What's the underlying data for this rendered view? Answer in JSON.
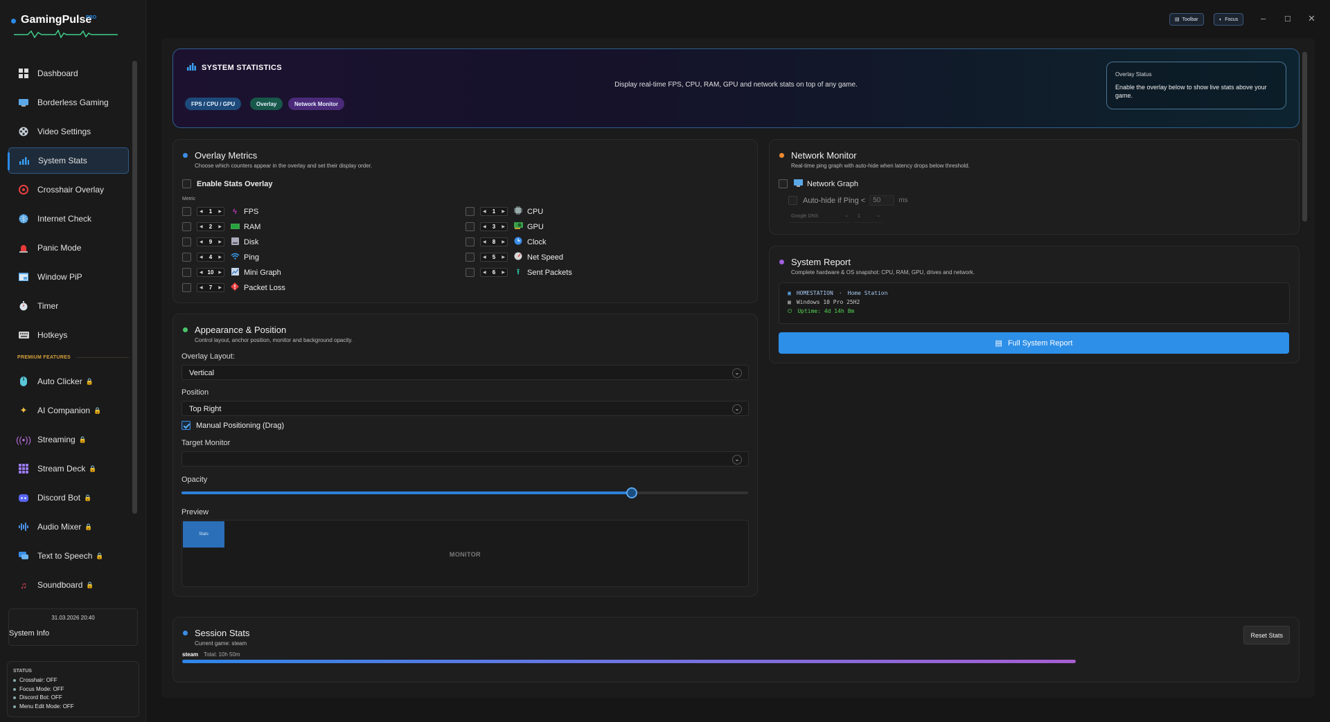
{
  "app": {
    "name": "GamingPulse",
    "badge": "PRO"
  },
  "window": {
    "toolbar_btn": "Toolbar",
    "focus_btn": "Focus"
  },
  "sidebar": {
    "items": [
      {
        "label": "Dashboard",
        "icon": "dashboard-icon"
      },
      {
        "label": "Borderless Gaming",
        "icon": "monitor-icon"
      },
      {
        "label": "Video Settings",
        "icon": "film-reel-icon"
      },
      {
        "label": "System Stats",
        "icon": "bar-chart-icon",
        "active": true
      },
      {
        "label": "Crosshair Overlay",
        "icon": "crosshair-icon"
      },
      {
        "label": "Internet Check",
        "icon": "globe-icon"
      },
      {
        "label": "Panic Mode",
        "icon": "siren-icon"
      },
      {
        "label": "Window PiP",
        "icon": "pip-window-icon"
      },
      {
        "label": "Timer",
        "icon": "stopwatch-icon"
      },
      {
        "label": "Hotkeys",
        "icon": "keyboard-icon"
      }
    ],
    "premium_label": "PREMIUM FEATURES",
    "premium_items": [
      {
        "label": "Auto Clicker",
        "icon": "mouse-icon"
      },
      {
        "label": "AI Companion",
        "icon": "sparkles-icon"
      },
      {
        "label": "Streaming",
        "icon": "broadcast-icon"
      },
      {
        "label": "Stream Deck",
        "icon": "grid-icon"
      },
      {
        "label": "Discord Bot",
        "icon": "discord-icon"
      },
      {
        "label": "Audio Mixer",
        "icon": "waveform-icon"
      },
      {
        "label": "Text to Speech",
        "icon": "speech-bubble-icon"
      },
      {
        "label": "Soundboard",
        "icon": "music-note-icon"
      }
    ],
    "datetime": "31.03.2026 20:40",
    "system_info": "System Info",
    "status": {
      "heading": "STATUS",
      "lines": [
        "Crosshair: OFF",
        "Focus Mode: OFF",
        "Discord Bot: OFF",
        "Menu Edit Mode: OFF"
      ]
    }
  },
  "banner": {
    "title": "SYSTEM STATISTICS",
    "description": "Display real-time FPS, CPU, RAM, GPU and network stats on top of any game.",
    "pills": [
      "FPS / CPU / GPU",
      "Overlay",
      "Network Monitor"
    ],
    "overlay_status_title": "Overlay Status",
    "overlay_status_text": "Enable the overlay below to show live stats above your game."
  },
  "overlay_metrics": {
    "title": "Overlay Metrics",
    "subtitle": "Choose which counters appear in the overlay and set their display order.",
    "enable_label": "Enable Stats Overlay",
    "metric_label": "Metric",
    "left": [
      {
        "order": "1",
        "label": "FPS",
        "icon": "lightning-icon"
      },
      {
        "order": "2",
        "label": "RAM",
        "icon": "ram-icon"
      },
      {
        "order": "9",
        "label": "Disk",
        "icon": "disk-icon"
      },
      {
        "order": "4",
        "label": "Ping",
        "icon": "wifi-icon"
      },
      {
        "order": "10",
        "label": "Mini Graph",
        "icon": "graph-icon"
      },
      {
        "order": "7",
        "label": "Packet Loss",
        "icon": "diamond-alert-icon"
      }
    ],
    "right": [
      {
        "order": "1",
        "label": "CPU",
        "icon": "cpu-chip-icon"
      },
      {
        "order": "3",
        "label": "GPU",
        "icon": "gpu-card-icon"
      },
      {
        "order": "8",
        "label": "Clock",
        "icon": "clock-icon"
      },
      {
        "order": "5",
        "label": "Net Speed",
        "icon": "speedometer-icon"
      },
      {
        "order": "6",
        "label": "Sent Packets",
        "icon": "upload-arrow-icon"
      }
    ]
  },
  "appearance": {
    "title": "Appearance & Position",
    "subtitle": "Control layout, anchor position, monitor and background opacity.",
    "layout_label": "Overlay Layout:",
    "layout_value": "Vertical",
    "position_label": "Position",
    "position_value": "Top Right",
    "manual_label": "Manual Positioning (Drag)",
    "monitor_label": "Target Monitor",
    "monitor_value": "",
    "opacity_label": "Opacity",
    "opacity_value": 0.795,
    "preview_label": "Preview",
    "preview_stats": "Stats",
    "preview_monitor": "MONITOR"
  },
  "network": {
    "title": "Network Monitor",
    "subtitle": "Real-time ping graph with auto-hide when latency drops below threshold.",
    "graph_label": "Network Graph",
    "autohide_label": "Auto-hide if Ping <",
    "autohide_value": "50",
    "autohide_unit": "ms",
    "dns_value": "Google DNS",
    "interval_value": "1"
  },
  "report": {
    "title": "System Report",
    "subtitle": "Complete hardware & OS snapshot: CPU, RAM, GPU, drives and network.",
    "host": "HOMESTATION",
    "sep": "·",
    "host_desc": "Home Station",
    "os": "Windows 10 Pro 25H2",
    "uptime": "Uptime: 4d 14h 8m",
    "button": "Full System Report"
  },
  "session": {
    "title": "Session Stats",
    "subtitle": "Current game: steam",
    "reset": "Reset Stats",
    "game": "steam",
    "total": "Total: 10h 50m"
  },
  "colors": {
    "accent": "#2b8be8",
    "premium": "#d7a23a",
    "uptime": "#57d657"
  }
}
